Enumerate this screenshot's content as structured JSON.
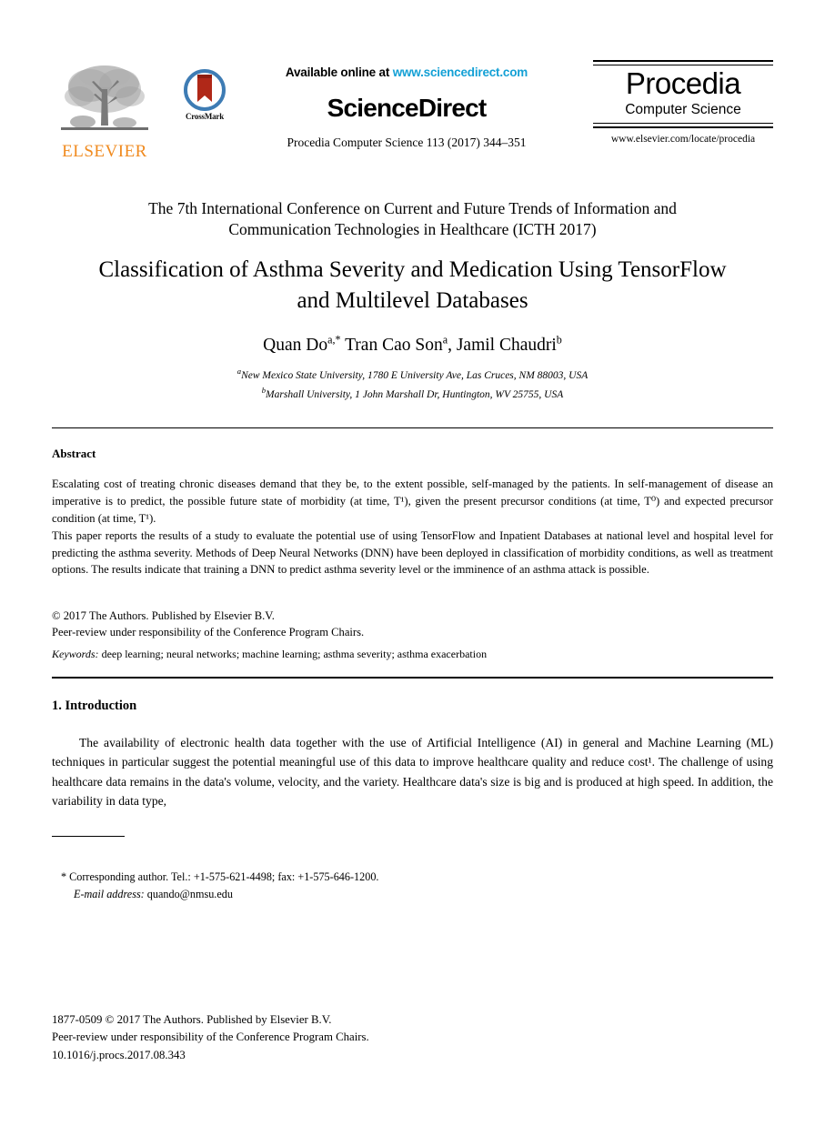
{
  "masthead": {
    "elsevier_wordmark": "ELSEVIER",
    "crossmark_label": "CrossMark",
    "available_prefix": "Available online at ",
    "available_link": "www.sciencedirect.com",
    "sciencedirect_wordmark": "ScienceDirect",
    "journal_citation": "Procedia Computer Science 113 (2017) 344–351",
    "procedia_title": "Procedia",
    "procedia_subtitle": "Computer Science",
    "procedia_url": "www.elsevier.com/locate/procedia"
  },
  "header": {
    "conference": "The 7th International Conference on Current and Future Trends of Information and Communication Technologies in Healthcare (ICTH 2017)",
    "paper_title": "Classification of Asthma Severity and Medication Using TensorFlow and Multilevel Databases"
  },
  "authors": {
    "line_html": "Quan Do<sup>a,</sup><sup>*</sup> Tran Cao Son<sup>a</sup>, Jamil Chaudri<sup>b</sup>",
    "plain": "Quan Do a,*, Tran Cao Son a, Jamil Chaudri b",
    "affiliations": [
      "New Mexico State University, 1780 E University Ave, Las Cruces, NM 88003, USA",
      "Marshall University, 1 John Marshall Dr, Huntington, WV 25755, USA"
    ],
    "affiliation_markers": [
      "a",
      "b"
    ]
  },
  "abstract": {
    "heading": "Abstract",
    "paragraph_1": "Escalating cost of treating chronic diseases demand that they be, to the extent possible, self-managed by the patients. In self-management of disease an imperative is to predict, the possible future state of morbidity (at time, T¹), given the present precursor conditions (at time, T⁰) and expected precursor condition (at time, T¹).",
    "paragraph_2": "This paper reports the results of a study to evaluate the potential use of using TensorFlow and Inpatient Databases at national level and hospital level for predicting the asthma severity. Methods of Deep Neural Networks (DNN) have been deployed in classification of morbidity conditions, as well as treatment options. The results indicate that training a DNN to predict asthma severity level or the imminence of an asthma attack is possible.",
    "copyright": "© 2017 The Authors. Published by Elsevier B.V.",
    "peer_review": "Peer-review under responsibility of the Conference Program Chairs.",
    "keywords_label": "Keywords:",
    "keywords_value": " deep learning; neural networks; machine learning; asthma severity; asthma exacerbation"
  },
  "introduction": {
    "heading": "1. Introduction",
    "paragraph_1": "The availability of electronic health data together with the use of Artificial Intelligence (AI) in general and Machine Learning (ML) techniques in particular suggest the potential meaningful use of this data to improve healthcare quality and reduce cost¹. The challenge of using healthcare data remains in the data's volume, velocity, and the variety. Healthcare data's size is big and is produced at high speed. In addition, the variability in data type,"
  },
  "footnote": {
    "corresponding": "* Corresponding author. Tel.: +1-575-621-4498; fax: +1-575-646-1200.",
    "email_label": "E-mail address:",
    "email_value": " quando@nmsu.edu"
  },
  "bottom": {
    "issn_line": "1877-0509 © 2017 The Authors. Published by Elsevier B.V.",
    "peer_review": "Peer-review under responsibility of the Conference Program Chairs.",
    "doi": "10.1016/j.procs.2017.08.343"
  },
  "colors": {
    "elsevier_orange": "#F08A1E",
    "sciencedirect_link_blue": "#13A0D5",
    "crossmark_blue": "#3E7CB4",
    "crossmark_red": "#B02818",
    "text_black": "#000000"
  }
}
